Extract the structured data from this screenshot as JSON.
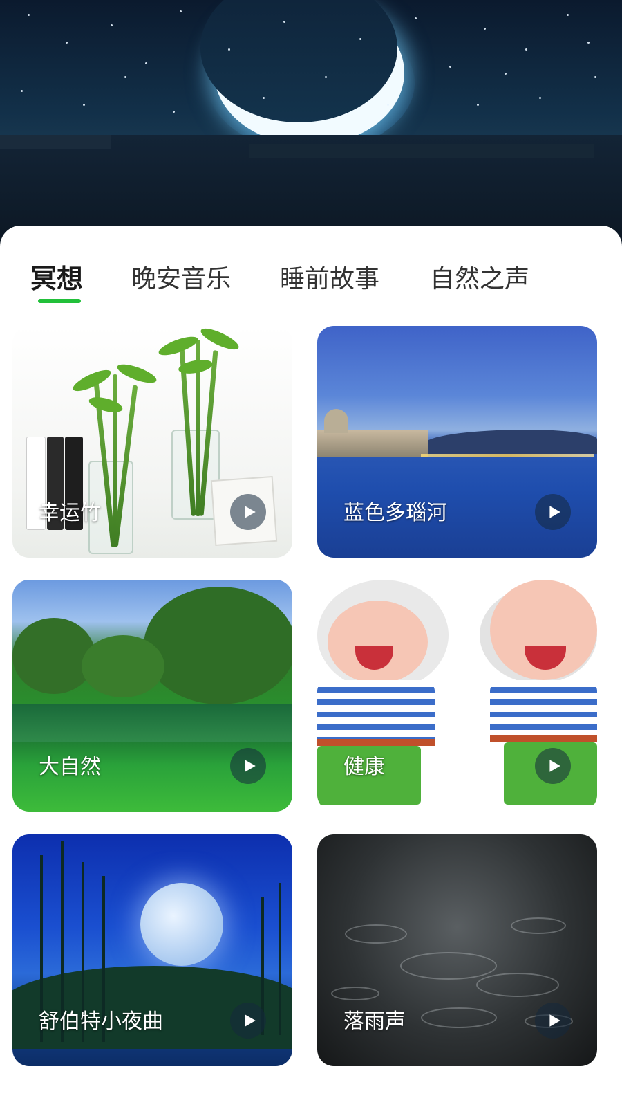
{
  "tabs": [
    {
      "label": "冥想",
      "active": true
    },
    {
      "label": "晚安音乐",
      "active": false
    },
    {
      "label": "睡前故事",
      "active": false
    },
    {
      "label": "自然之声",
      "active": false
    }
  ],
  "cards": [
    {
      "title": "幸运竹",
      "icon": "play-icon"
    },
    {
      "title": "蓝色多瑙河",
      "icon": "play-icon"
    },
    {
      "title": "大自然",
      "icon": "play-icon"
    },
    {
      "title": "健康",
      "icon": "play-icon"
    },
    {
      "title": "舒伯特小夜曲",
      "icon": "play-icon"
    },
    {
      "title": "落雨声",
      "icon": "play-icon"
    }
  ],
  "colors": {
    "accent": "#22c03a",
    "text_primary": "#1a1a1a",
    "text_secondary": "#333333",
    "sheet_background": "#ffffff"
  }
}
